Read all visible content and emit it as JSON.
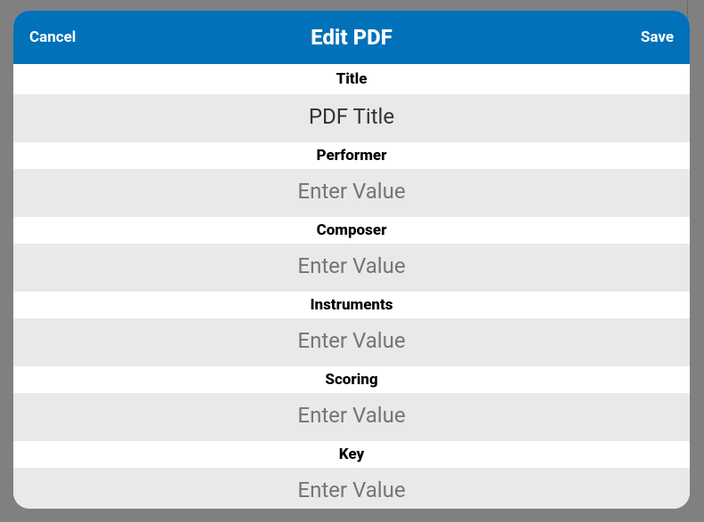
{
  "header": {
    "cancel_label": "Cancel",
    "title": "Edit PDF",
    "save_label": "Save"
  },
  "fields": [
    {
      "label": "Title",
      "value": "PDF Title",
      "placeholder": "Enter Value"
    },
    {
      "label": "Performer",
      "value": "",
      "placeholder": "Enter Value"
    },
    {
      "label": "Composer",
      "value": "",
      "placeholder": "Enter Value"
    },
    {
      "label": "Instruments",
      "value": "",
      "placeholder": "Enter Value"
    },
    {
      "label": "Scoring",
      "value": "",
      "placeholder": "Enter Value"
    },
    {
      "label": "Key",
      "value": "",
      "placeholder": "Enter Value"
    }
  ]
}
